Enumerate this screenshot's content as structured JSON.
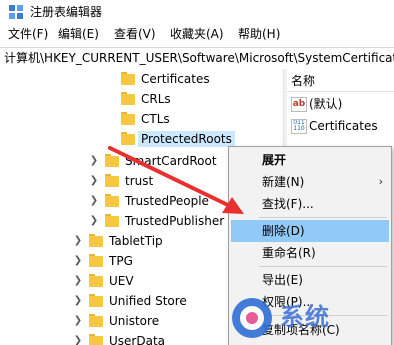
{
  "window": {
    "title": "注册表编辑器"
  },
  "menu": [
    "文件(F)",
    "编辑(E)",
    "查看(V)",
    "收藏夹(A)",
    "帮助(H)"
  ],
  "address": "计算机\\HKEY_CURRENT_USER\\Software\\Microsoft\\SystemCertificates",
  "tree": {
    "items": [
      {
        "label": "Certificates",
        "expander": false,
        "selected": false
      },
      {
        "label": "CRLs",
        "expander": false,
        "selected": false
      },
      {
        "label": "CTLs",
        "expander": false,
        "selected": false
      },
      {
        "label": "ProtectedRoots",
        "expander": false,
        "selected": true
      },
      {
        "label": "SmartCardRoot",
        "expander": true,
        "selected": false
      },
      {
        "label": "trust",
        "expander": true,
        "selected": false
      },
      {
        "label": "TrustedPeople",
        "expander": true,
        "selected": false
      },
      {
        "label": "TrustedPublisher",
        "expander": true,
        "selected": false
      },
      {
        "label": "TabletTip",
        "expander": true,
        "selected": false
      },
      {
        "label": "TPG",
        "expander": true,
        "selected": false
      },
      {
        "label": "UEV",
        "expander": true,
        "selected": false
      },
      {
        "label": "Unified Store",
        "expander": true,
        "selected": false
      },
      {
        "label": "Unistore",
        "expander": true,
        "selected": false
      },
      {
        "label": "UserData",
        "expander": true,
        "selected": false
      }
    ]
  },
  "right_pane": {
    "column_name": "名称",
    "values": [
      {
        "icon": "string-value-icon",
        "label": "(默认)"
      },
      {
        "icon": "binary-value-icon",
        "label": "Certificates"
      }
    ]
  },
  "context_menu": {
    "items": [
      {
        "label": "展开",
        "bold": true,
        "submenu": false,
        "highlight": false
      },
      {
        "label": "新建(N)",
        "bold": false,
        "submenu": true,
        "highlight": false
      },
      {
        "label": "查找(F)...",
        "bold": false,
        "submenu": false,
        "highlight": false
      },
      {
        "label": "删除(D)",
        "bold": false,
        "submenu": false,
        "highlight": true
      },
      {
        "label": "重命名(R)",
        "bold": false,
        "submenu": false,
        "highlight": false
      },
      {
        "label": "导出(E)",
        "bold": false,
        "submenu": false,
        "highlight": false
      },
      {
        "label": "权限(P)...",
        "bold": false,
        "submenu": false,
        "highlight": false
      },
      {
        "label": "复制项名称(C)",
        "bold": false,
        "submenu": false,
        "highlight": false
      }
    ]
  },
  "watermark": {
    "text": "系统"
  },
  "colors": {
    "selection": "#cce8ff",
    "menu_highlight": "#91c9f7",
    "arrow": "#e8312f",
    "folder": "#f6c842"
  }
}
